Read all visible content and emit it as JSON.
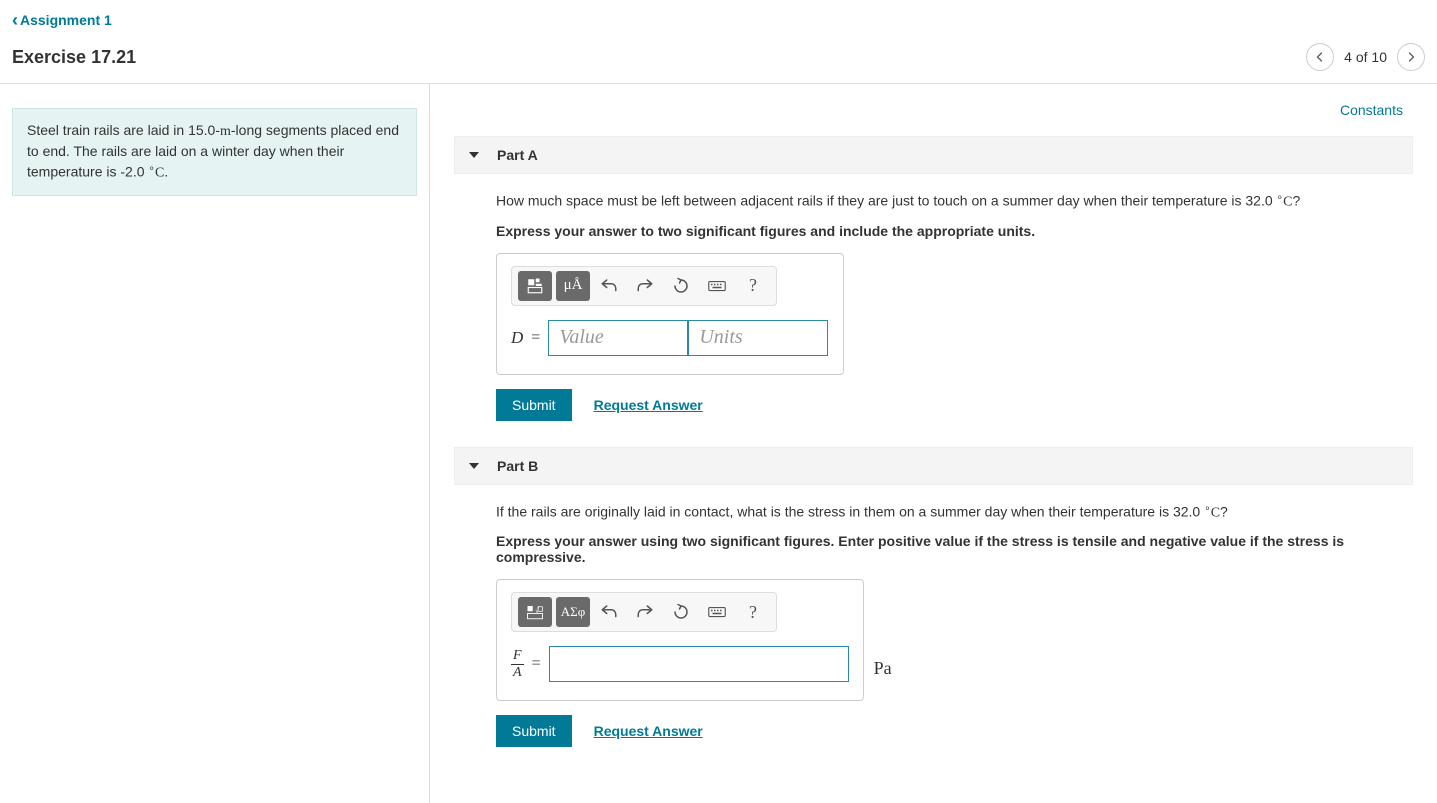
{
  "nav": {
    "back_label": "Assignment 1",
    "exercise_title": "Exercise 17.21",
    "position": "4 of 10"
  },
  "links": {
    "constants": "Constants"
  },
  "problem": {
    "text_html": "Steel train rails are laid in 15.0-<span class='rm'>m</span>-long segments placed end to end. The rails are laid on a winter day when their temperature is -2.0 <span class='deg'>∘</span><span class='rm'>C</span>."
  },
  "partA": {
    "title": "Part A",
    "question_html": "How much space must be left between adjacent rails if they are just to touch on a summer day when their temperature is 32.0 <span class='deg'>∘</span><span class='rm'>C</span>?",
    "instruction": "Express your answer to two significant figures and include the appropriate units.",
    "variable": "D",
    "value_placeholder": "Value",
    "units_placeholder": "Units",
    "submit_label": "Submit",
    "request_label": "Request Answer",
    "tool_units_label": "μÅ"
  },
  "partB": {
    "title": "Part B",
    "question_html": "If the rails are originally laid in contact, what is the stress in them on a summer day when their temperature is 32.0 <span class='deg'>∘</span><span class='rm'>C</span>?",
    "instruction": "Express your answer using two significant figures. Enter positive value if the stress is tensile and negative value if the stress is compressive.",
    "frac_num": "F",
    "frac_den": "A",
    "unit_static": "Pa",
    "submit_label": "Submit",
    "request_label": "Request Answer",
    "tool_greek_label": "ΑΣφ"
  }
}
